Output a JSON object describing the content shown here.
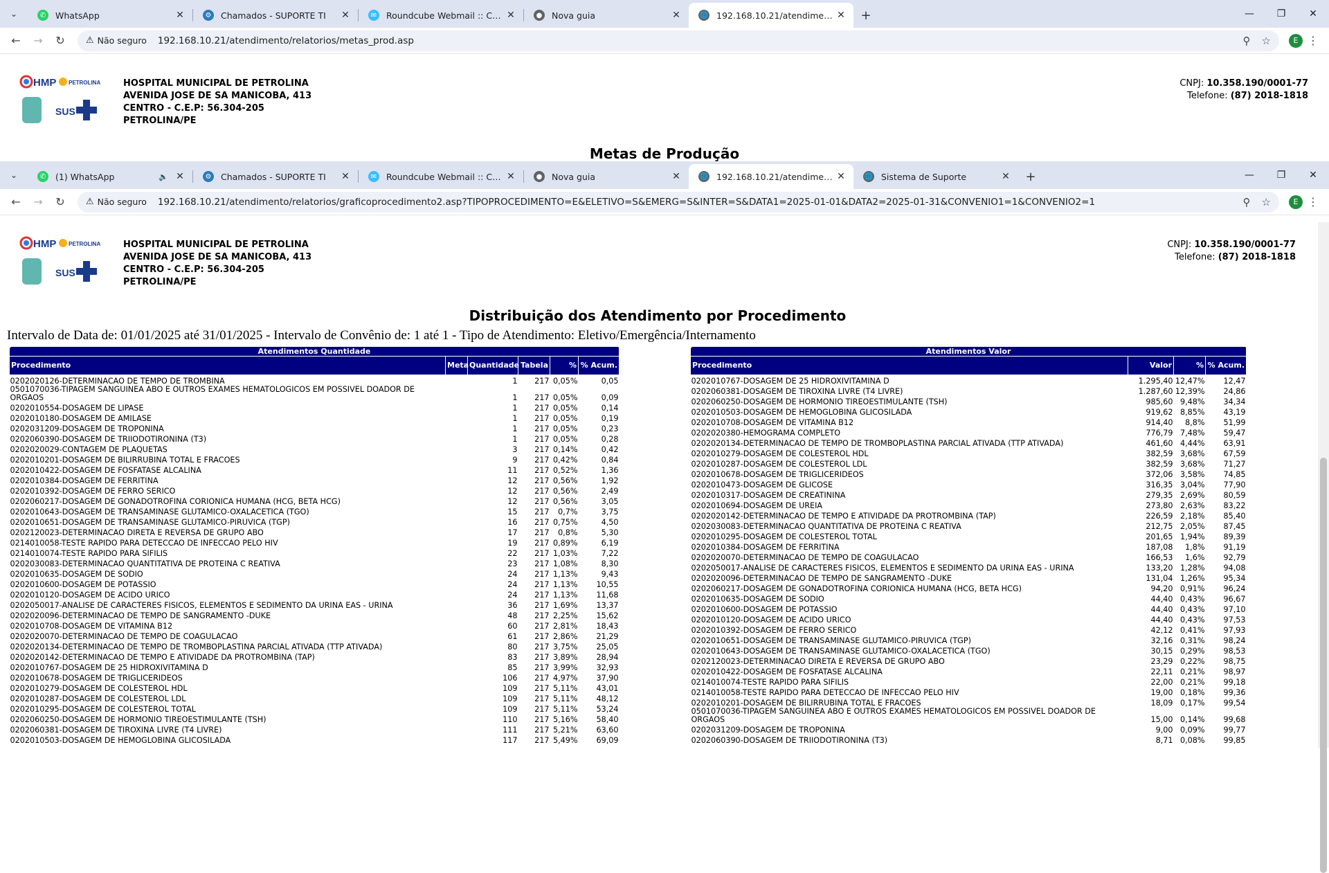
{
  "window1": {
    "tabs": [
      {
        "label": "WhatsApp",
        "icon": "whatsapp-icon",
        "active": false
      },
      {
        "label": "Chamados - SUPORTE TI",
        "icon": "gear-icon",
        "active": false
      },
      {
        "label": "Roundcube Webmail :: Caixa de",
        "icon": "roundcube-icon",
        "active": false
      },
      {
        "label": "Nova guia",
        "icon": "chrome-icon",
        "active": false
      },
      {
        "label": "192.168.10.21/atendimento/rela",
        "icon": "globe-icon",
        "active": true
      }
    ],
    "security_label": "Não seguro",
    "url": "192.168.10.21/atendimento/relatorios/metas_prod.asp",
    "profile_initial": "E"
  },
  "window2": {
    "tabs": [
      {
        "label": "(1) WhatsApp",
        "icon": "whatsapp-icon",
        "active": false,
        "sound": true
      },
      {
        "label": "Chamados - SUPORTE TI",
        "icon": "gear-icon",
        "active": false
      },
      {
        "label": "Roundcube Webmail :: Caixa de",
        "icon": "roundcube-icon",
        "active": false
      },
      {
        "label": "Nova guia",
        "icon": "chrome-icon",
        "active": false
      },
      {
        "label": "192.168.10.21/atendimento/rela",
        "icon": "globe-icon",
        "active": true
      },
      {
        "label": "Sistema de Suporte",
        "icon": "globe-icon",
        "active": false
      }
    ],
    "security_label": "Não seguro",
    "url": "192.168.10.21/atendimento/relatorios/graficoprocedimento2.asp?TIPOPROCEDIMENTO=E&ELETIVO=S&EMERG=S&INTER=S&DATA1=2025-01-01&DATA2=2025-01-31&CONVENIO1=1&CONVENIO2=1",
    "profile_initial": "E"
  },
  "hospital": {
    "name": "HOSPITAL MUNICIPAL DE PETROLINA",
    "address": "AVENIDA JOSE DE SA MANICOBA, 413",
    "district": "CENTRO - C.E.P: 56.304-205",
    "city": "PETROLINA/PE",
    "cnpj_label": "CNPJ:",
    "cnpj": "10.358.190/0001-77",
    "phone_label": "Telefone:",
    "phone": "(87) 2018-1818",
    "logo_text_hmp": "HMP",
    "logo_text_petrolina": "PETROLINA",
    "logo_text_sus": "SUS"
  },
  "page1_title": "Metas de Produção",
  "report": {
    "title": "Distribuição dos Atendimento por Procedimento",
    "subtitle": "Intervalo de Data de: 01/01/2025 até 31/01/2025 - Intervalo de Convênio de: 1 até 1 - Tipo de Atendimento: Eletivo/Emergência/Internamento"
  },
  "qty_table": {
    "group_header": "Atendimentos Quantidade",
    "headers": [
      "Procedimento",
      "Meta",
      "Quantidade",
      "Tabela",
      "%",
      "% Acum."
    ],
    "rows": [
      [
        "0202020126-DETERMINACAO DE TEMPO DE TROMBINA",
        "",
        "1",
        "217",
        "0,05%",
        "0,05"
      ],
      [
        "0501070036-TIPAGEM SANGUINEA ABO E OUTROS EXAMES HEMATOLOGICOS EM POSSIVEL DOADOR DE ORGAOS",
        "",
        "1",
        "217",
        "0,05%",
        "0,09"
      ],
      [
        "0202010554-DOSAGEM DE LIPASE",
        "",
        "1",
        "217",
        "0,05%",
        "0,14"
      ],
      [
        "0202010180-DOSAGEM DE AMILASE",
        "",
        "1",
        "217",
        "0,05%",
        "0,19"
      ],
      [
        "0202031209-DOSAGEM DE TROPONINA",
        "",
        "1",
        "217",
        "0,05%",
        "0,23"
      ],
      [
        "0202060390-DOSAGEM DE TRIIODOTIRONINA (T3)",
        "",
        "1",
        "217",
        "0,05%",
        "0,28"
      ],
      [
        "0202020029-CONTAGEM DE PLAQUETAS",
        "",
        "3",
        "217",
        "0,14%",
        "0,42"
      ],
      [
        "0202010201-DOSAGEM DE BILIRRUBINA TOTAL E FRACOES",
        "",
        "9",
        "217",
        "0,42%",
        "0,84"
      ],
      [
        "0202010422-DOSAGEM DE FOSFATASE ALCALINA",
        "",
        "11",
        "217",
        "0,52%",
        "1,36"
      ],
      [
        "0202010384-DOSAGEM DE FERRITINA",
        "",
        "12",
        "217",
        "0,56%",
        "1,92"
      ],
      [
        "0202010392-DOSAGEM DE FERRO SERICO",
        "",
        "12",
        "217",
        "0,56%",
        "2,49"
      ],
      [
        "0202060217-DOSAGEM DE GONADOTROFINA CORIONICA HUMANA (HCG, BETA HCG)",
        "",
        "12",
        "217",
        "0,56%",
        "3,05"
      ],
      [
        "0202010643-DOSAGEM DE TRANSAMINASE GLUTAMICO-OXALACETICA (TGO)",
        "",
        "15",
        "217",
        "0,7%",
        "3,75"
      ],
      [
        "0202010651-DOSAGEM DE TRANSAMINASE GLUTAMICO-PIRUVICA (TGP)",
        "",
        "16",
        "217",
        "0,75%",
        "4,50"
      ],
      [
        "0202120023-DETERMINACAO DIRETA E REVERSA DE GRUPO ABO",
        "",
        "17",
        "217",
        "0,8%",
        "5,30"
      ],
      [
        "0214010058-TESTE RAPIDO PARA DETECCAO DE INFECCAO PELO HIV",
        "",
        "19",
        "217",
        "0,89%",
        "6,19"
      ],
      [
        "0214010074-TESTE RAPIDO PARA SIFILIS",
        "",
        "22",
        "217",
        "1,03%",
        "7,22"
      ],
      [
        "0202030083-DETERMINACAO QUANTITATIVA DE PROTEINA C REATIVA",
        "",
        "23",
        "217",
        "1,08%",
        "8,30"
      ],
      [
        "0202010635-DOSAGEM DE SODIO",
        "",
        "24",
        "217",
        "1,13%",
        "9,43"
      ],
      [
        "0202010600-DOSAGEM DE POTASSIO",
        "",
        "24",
        "217",
        "1,13%",
        "10,55"
      ],
      [
        "0202010120-DOSAGEM DE ACIDO URICO",
        "",
        "24",
        "217",
        "1,13%",
        "11,68"
      ],
      [
        "0202050017-ANALISE DE CARACTERES FISICOS, ELEMENTOS E SEDIMENTO DA URINA EAS - URINA",
        "",
        "36",
        "217",
        "1,69%",
        "13,37"
      ],
      [
        "0202020096-DETERMINACAO DE TEMPO DE SANGRAMENTO -DUKE",
        "",
        "48",
        "217",
        "2,25%",
        "15,62"
      ],
      [
        "0202010708-DOSAGEM DE VITAMINA B12",
        "",
        "60",
        "217",
        "2,81%",
        "18,43"
      ],
      [
        "0202020070-DETERMINACAO DE TEMPO DE COAGULACAO",
        "",
        "61",
        "217",
        "2,86%",
        "21,29"
      ],
      [
        "0202020134-DETERMINACAO DE TEMPO DE TROMBOPLASTINA PARCIAL ATIVADA (TTP ATIVADA)",
        "",
        "80",
        "217",
        "3,75%",
        "25,05"
      ],
      [
        "0202020142-DETERMINACAO DE TEMPO E ATIVIDADE DA PROTROMBINA (TAP)",
        "",
        "83",
        "217",
        "3,89%",
        "28,94"
      ],
      [
        "0202010767-DOSAGEM DE 25 HIDROXIVITAMINA D",
        "",
        "85",
        "217",
        "3,99%",
        "32,93"
      ],
      [
        "0202010678-DOSAGEM DE TRIGLICERIDEOS",
        "",
        "106",
        "217",
        "4,97%",
        "37,90"
      ],
      [
        "0202010279-DOSAGEM DE COLESTEROL HDL",
        "",
        "109",
        "217",
        "5,11%",
        "43,01"
      ],
      [
        "0202010287-DOSAGEM DE COLESTEROL LDL",
        "",
        "109",
        "217",
        "5,11%",
        "48,12"
      ],
      [
        "0202010295-DOSAGEM DE COLESTEROL TOTAL",
        "",
        "109",
        "217",
        "5,11%",
        "53,24"
      ],
      [
        "0202060250-DOSAGEM DE HORMONIO TIREOESTIMULANTE (TSH)",
        "",
        "110",
        "217",
        "5,16%",
        "58,40"
      ],
      [
        "0202060381-DOSAGEM DE TIROXINA LIVRE (T4 LIVRE)",
        "",
        "111",
        "217",
        "5,21%",
        "63,60"
      ],
      [
        "0202010503-DOSAGEM DE HEMOGLOBINA GLICOSILADA",
        "",
        "117",
        "217",
        "5,49%",
        "69,09"
      ]
    ]
  },
  "val_table": {
    "group_header": "Atendimentos Valor",
    "headers": [
      "Procedimento",
      "Valor",
      "%",
      "% Acum."
    ],
    "rows": [
      [
        "0202010767-DOSAGEM DE 25 HIDROXIVITAMINA D",
        "1.295,40",
        "12,47%",
        "12,47"
      ],
      [
        "0202060381-DOSAGEM DE TIROXINA LIVRE (T4 LIVRE)",
        "1.287,60",
        "12,39%",
        "24,86"
      ],
      [
        "0202060250-DOSAGEM DE HORMONIO TIREOESTIMULANTE (TSH)",
        "985,60",
        "9,48%",
        "34,34"
      ],
      [
        "0202010503-DOSAGEM DE HEMOGLOBINA GLICOSILADA",
        "919,62",
        "8,85%",
        "43,19"
      ],
      [
        "0202010708-DOSAGEM DE VITAMINA B12",
        "914,40",
        "8,8%",
        "51,99"
      ],
      [
        "0202020380-HEMOGRAMA COMPLETO",
        "776,79",
        "7,48%",
        "59,47"
      ],
      [
        "0202020134-DETERMINACAO DE TEMPO DE TROMBOPLASTINA PARCIAL ATIVADA (TTP ATIVADA)",
        "461,60",
        "4,44%",
        "63,91"
      ],
      [
        "0202010279-DOSAGEM DE COLESTEROL HDL",
        "382,59",
        "3,68%",
        "67,59"
      ],
      [
        "0202010287-DOSAGEM DE COLESTEROL LDL",
        "382,59",
        "3,68%",
        "71,27"
      ],
      [
        "0202010678-DOSAGEM DE TRIGLICERIDEOS",
        "372,06",
        "3,58%",
        "74,85"
      ],
      [
        "0202010473-DOSAGEM DE GLICOSE",
        "316,35",
        "3,04%",
        "77,90"
      ],
      [
        "0202010317-DOSAGEM DE CREATININA",
        "279,35",
        "2,69%",
        "80,59"
      ],
      [
        "0202010694-DOSAGEM DE UREIA",
        "273,80",
        "2,63%",
        "83,22"
      ],
      [
        "0202020142-DETERMINACAO DE TEMPO E ATIVIDADE DA PROTROMBINA (TAP)",
        "226,59",
        "2,18%",
        "85,40"
      ],
      [
        "0202030083-DETERMINACAO QUANTITATIVA DE PROTEINA C REATIVA",
        "212,75",
        "2,05%",
        "87,45"
      ],
      [
        "0202010295-DOSAGEM DE COLESTEROL TOTAL",
        "201,65",
        "1,94%",
        "89,39"
      ],
      [
        "0202010384-DOSAGEM DE FERRITINA",
        "187,08",
        "1,8%",
        "91,19"
      ],
      [
        "0202020070-DETERMINACAO DE TEMPO DE COAGULACAO",
        "166,53",
        "1,6%",
        "92,79"
      ],
      [
        "0202050017-ANALISE DE CARACTERES FISICOS, ELEMENTOS E SEDIMENTO DA URINA EAS - URINA",
        "133,20",
        "1,28%",
        "94,08"
      ],
      [
        "0202020096-DETERMINACAO DE TEMPO DE SANGRAMENTO -DUKE",
        "131,04",
        "1,26%",
        "95,34"
      ],
      [
        "0202060217-DOSAGEM DE GONADOTROFINA CORIONICA HUMANA (HCG, BETA HCG)",
        "94,20",
        "0,91%",
        "96,24"
      ],
      [
        "0202010635-DOSAGEM DE SODIO",
        "44,40",
        "0,43%",
        "96,67"
      ],
      [
        "0202010600-DOSAGEM DE POTASSIO",
        "44,40",
        "0,43%",
        "97,10"
      ],
      [
        "0202010120-DOSAGEM DE ACIDO URICO",
        "44,40",
        "0,43%",
        "97,53"
      ],
      [
        "0202010392-DOSAGEM DE FERRO SERICO",
        "42,12",
        "0,41%",
        "97,93"
      ],
      [
        "0202010651-DOSAGEM DE TRANSAMINASE GLUTAMICO-PIRUVICA (TGP)",
        "32,16",
        "0,31%",
        "98,24"
      ],
      [
        "0202010643-DOSAGEM DE TRANSAMINASE GLUTAMICO-OXALACETICA (TGO)",
        "30,15",
        "0,29%",
        "98,53"
      ],
      [
        "0202120023-DETERMINACAO DIRETA E REVERSA DE GRUPO ABO",
        "23,29",
        "0,22%",
        "98,75"
      ],
      [
        "0202010422-DOSAGEM DE FOSFATASE ALCALINA",
        "22,11",
        "0,21%",
        "98,97"
      ],
      [
        "0214010074-TESTE RAPIDO PARA SIFILIS",
        "22,00",
        "0,21%",
        "99,18"
      ],
      [
        "0214010058-TESTE RAPIDO PARA DETECCAO DE INFECCAO PELO HIV",
        "19,00",
        "0,18%",
        "99,36"
      ],
      [
        "0202010201-DOSAGEM DE BILIRRUBINA TOTAL E FRACOES",
        "18,09",
        "0,17%",
        "99,54"
      ],
      [
        "0501070036-TIPAGEM SANGUINEA ABO E OUTROS EXAMES HEMATOLOGICOS EM POSSIVEL DOADOR DE ORGAOS",
        "15,00",
        "0,14%",
        "99,68"
      ],
      [
        "0202031209-DOSAGEM DE TROPONINA",
        "9,00",
        "0,09%",
        "99,77"
      ],
      [
        "0202060390-DOSAGEM DE TRIIODOTIRONINA (T3)",
        "8,71",
        "0,08%",
        "99,85"
      ]
    ]
  },
  "colors": {
    "table_header": "#000080",
    "tabbar": "#dee3f2",
    "omnibox": "#eef1f8"
  }
}
